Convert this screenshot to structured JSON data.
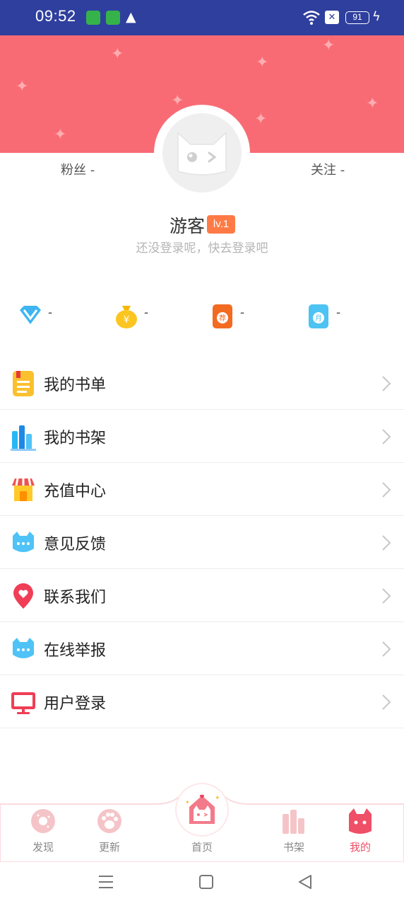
{
  "status_bar": {
    "time": "09:52",
    "battery": "91",
    "icons": [
      "sim-icon",
      "shield-icon",
      "warning-icon",
      "wifi-icon",
      "notification-x-icon",
      "battery-icon",
      "charging-icon"
    ]
  },
  "profile": {
    "fans_label": "粉丝 -",
    "follow_label": "关注 -",
    "username": "游客",
    "level": "lv.1",
    "login_hint": "还没登录呢，快去登录吧"
  },
  "stats": [
    {
      "icon": "diamond-icon",
      "value": "-"
    },
    {
      "icon": "money-bag-icon",
      "value": "-"
    },
    {
      "icon": "recommend-ticket-icon",
      "value": "-"
    },
    {
      "icon": "monthly-ticket-icon",
      "value": "-"
    }
  ],
  "menu": [
    {
      "label": "我的书单",
      "icon": "book-list-icon"
    },
    {
      "label": "我的书架",
      "icon": "bookshelf-icon"
    },
    {
      "label": "充值中心",
      "icon": "store-icon"
    },
    {
      "label": "意见反馈",
      "icon": "cat-chat-icon"
    },
    {
      "label": "联系我们",
      "icon": "location-heart-icon"
    },
    {
      "label": "在线举报",
      "icon": "cat-chat-icon"
    },
    {
      "label": "用户登录",
      "icon": "monitor-icon"
    }
  ],
  "bottom_nav": [
    {
      "label": "发现",
      "icon": "donut-icon"
    },
    {
      "label": "更新",
      "icon": "paw-icon"
    },
    {
      "label": "首页",
      "icon": "home-cat-icon"
    },
    {
      "label": "书架",
      "icon": "books-icon"
    },
    {
      "label": "我的",
      "icon": "cat-profile-icon"
    }
  ],
  "colors": {
    "status_bar": "#2f3f9e",
    "banner": "#f96b74",
    "level_badge": "#ff7a45",
    "active_tab": "#ef4f67"
  }
}
